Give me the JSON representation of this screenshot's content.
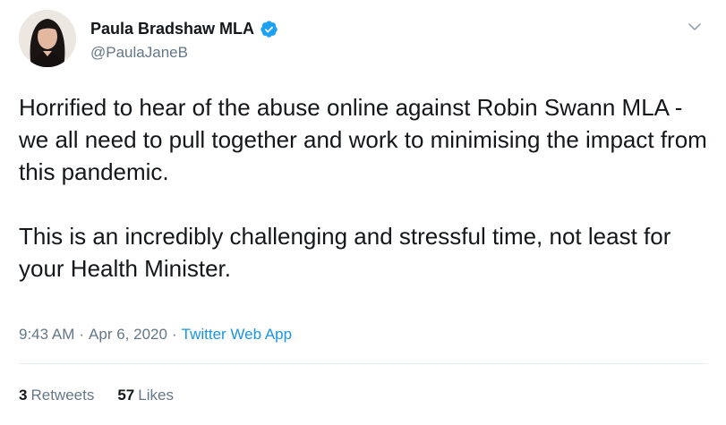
{
  "author": {
    "display_name": "Paula Bradshaw MLA",
    "handle": "@PaulaJaneB",
    "verified_icon": "verified-badge-icon",
    "avatar_icon": "profile-photo"
  },
  "tweet": {
    "paragraphs": [
      "Horrified to hear of the abuse online against Robin Swann MLA - we all need to pull together and work to minimising the impact from this pandemic.",
      "This is an incredibly challenging and stressful time, not least for your Health Minister."
    ],
    "time": "9:43 AM",
    "separator": "·",
    "date": "Apr 6, 2020",
    "source": "Twitter Web App"
  },
  "stats": {
    "retweets_count": "3",
    "retweets_label": "Retweets",
    "likes_count": "57",
    "likes_label": "Likes"
  },
  "colors": {
    "accent": "#1b95e0",
    "secondary_text": "#657786",
    "divider": "#e6ecf0"
  },
  "icons": {
    "menu": "chevron-down-icon"
  }
}
